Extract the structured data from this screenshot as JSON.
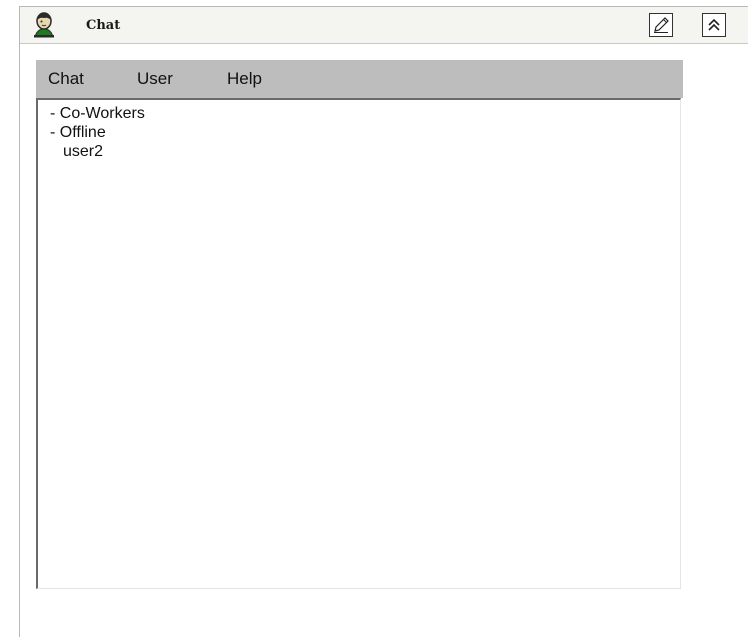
{
  "window": {
    "title": "Chat",
    "title_icon": "user-head-icon",
    "buttons": {
      "edit_icon": "pencil-icon",
      "collapse_icon": "double-chevron-up-icon"
    }
  },
  "menubar": {
    "items": [
      {
        "label": "Chat"
      },
      {
        "label": "User"
      },
      {
        "label": "Help"
      }
    ]
  },
  "tree": {
    "groups": [
      {
        "label": "- Co-Workers"
      },
      {
        "label": "- Offline",
        "children": [
          {
            "label": "user2"
          }
        ]
      }
    ]
  },
  "colors": {
    "titlebar_bg": "#f4f4f0",
    "menubar_bg": "#bdbdbd",
    "tree_bg": "#ffffff"
  }
}
